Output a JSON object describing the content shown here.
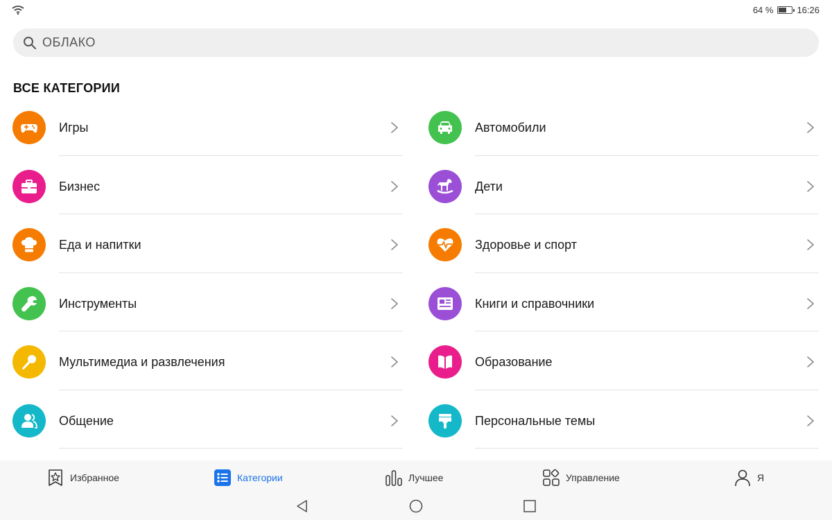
{
  "status": {
    "battery_text": "64 %",
    "battery_level": 0.64,
    "time": "16:26"
  },
  "search": {
    "placeholder": "ОБЛАКО"
  },
  "section_title": "ВСЕ КАТЕГОРИИ",
  "categories_left": [
    {
      "label": "Игры",
      "icon": "gamepad-icon",
      "color": "#f57c00"
    },
    {
      "label": "Бизнес",
      "icon": "briefcase-icon",
      "color": "#e91e8c"
    },
    {
      "label": "Еда и напитки",
      "icon": "chef-hat-icon",
      "color": "#f57c00"
    },
    {
      "label": "Инструменты",
      "icon": "wrench-icon",
      "color": "#43c24f"
    },
    {
      "label": "Мультимедиа и развлечения",
      "icon": "microphone-icon",
      "color": "#f5b800"
    },
    {
      "label": "Общение",
      "icon": "people-icon",
      "color": "#14b8c8"
    }
  ],
  "categories_right": [
    {
      "label": "Автомобили",
      "icon": "car-icon",
      "color": "#43c24f"
    },
    {
      "label": "Дети",
      "icon": "rocking-horse-icon",
      "color": "#9b4fd6"
    },
    {
      "label": "Здоровье и спорт",
      "icon": "heartbeat-icon",
      "color": "#f57c00"
    },
    {
      "label": "Книги и справочники",
      "icon": "newspaper-icon",
      "color": "#9b4fd6"
    },
    {
      "label": "Образование",
      "icon": "book-icon",
      "color": "#e91e8c"
    },
    {
      "label": "Персональные темы",
      "icon": "paint-brush-icon",
      "color": "#14b8c8"
    }
  ],
  "bottom_tabs": [
    {
      "label": "Избранное",
      "icon": "star-bookmark-icon",
      "active": false
    },
    {
      "label": "Категории",
      "icon": "list-icon",
      "active": true
    },
    {
      "label": "Лучшее",
      "icon": "bar-chart-icon",
      "active": false
    },
    {
      "label": "Управление",
      "icon": "grid-apps-icon",
      "active": false
    },
    {
      "label": "Я",
      "icon": "person-icon",
      "active": false
    }
  ],
  "colors": {
    "accent": "#1a73e8"
  }
}
